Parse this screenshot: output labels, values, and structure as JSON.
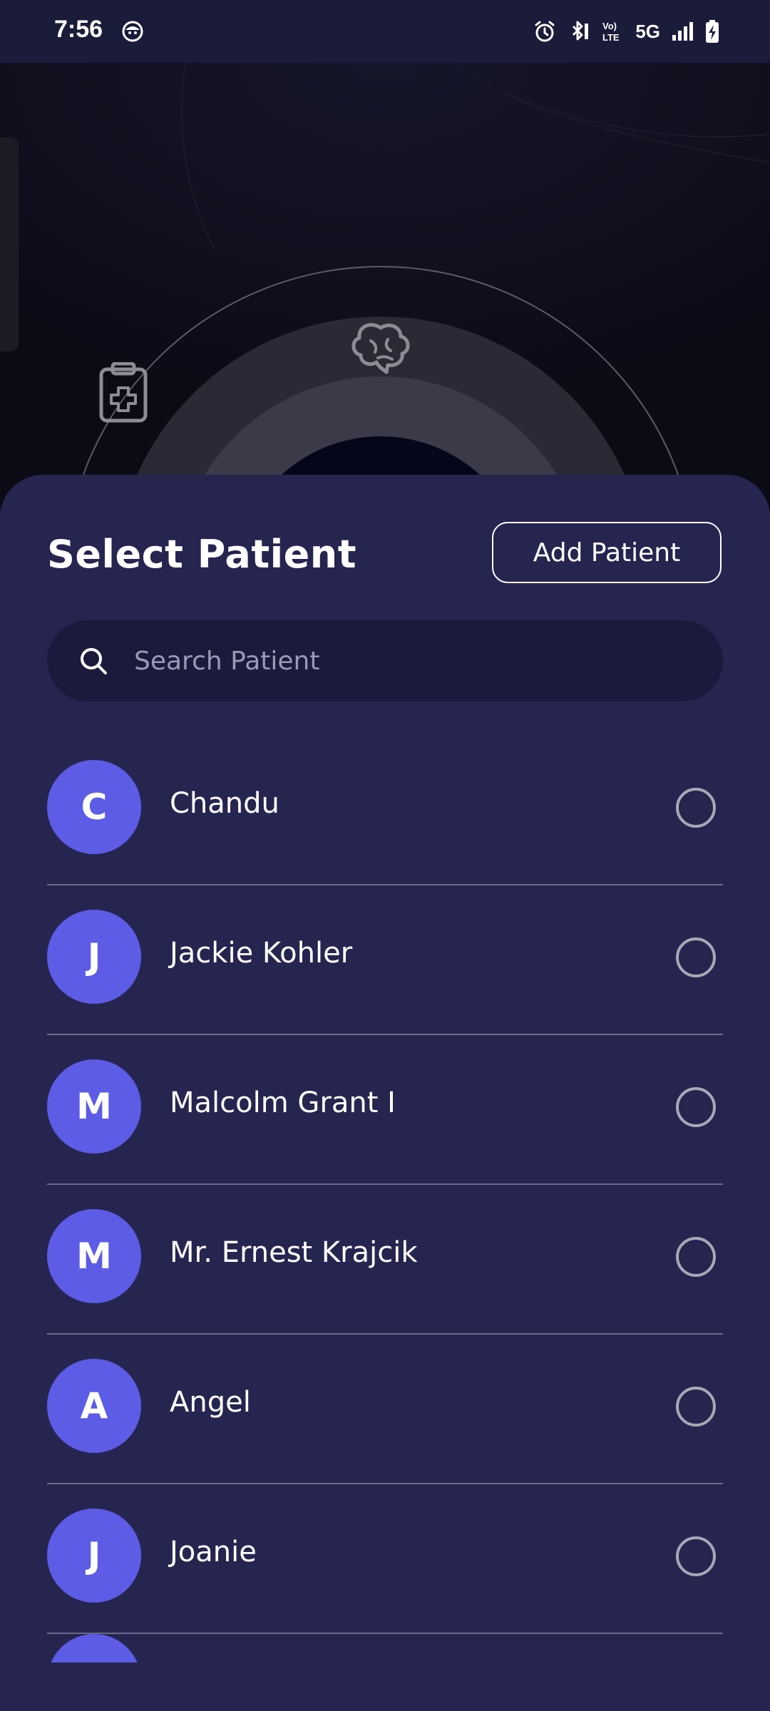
{
  "status_bar": {
    "time": "7:56",
    "network": "5G",
    "icons": [
      "face-icon",
      "alarm-icon",
      "bluetooth-icon",
      "volte-icon",
      "signal-icon",
      "battery-charging-icon"
    ]
  },
  "sheet": {
    "title": "Select Patient",
    "add_button_label": "Add Patient",
    "search": {
      "placeholder": "Search Patient",
      "value": ""
    }
  },
  "patients": [
    {
      "initial": "C",
      "name": "Chandu",
      "selected": false
    },
    {
      "initial": "J",
      "name": "Jackie Kohler",
      "selected": false
    },
    {
      "initial": "M",
      "name": "Malcolm Grant I",
      "selected": false
    },
    {
      "initial": "M",
      "name": "Mr. Ernest Krajcik",
      "selected": false
    },
    {
      "initial": "A",
      "name": "Angel",
      "selected": false
    },
    {
      "initial": "J",
      "name": "Joanie",
      "selected": false
    }
  ],
  "colors": {
    "sheet_bg": "#262550",
    "avatar_bg": "#5c5ce6",
    "status_bar_bg": "#1b1b3a",
    "search_bg": "#1b1a3d"
  }
}
